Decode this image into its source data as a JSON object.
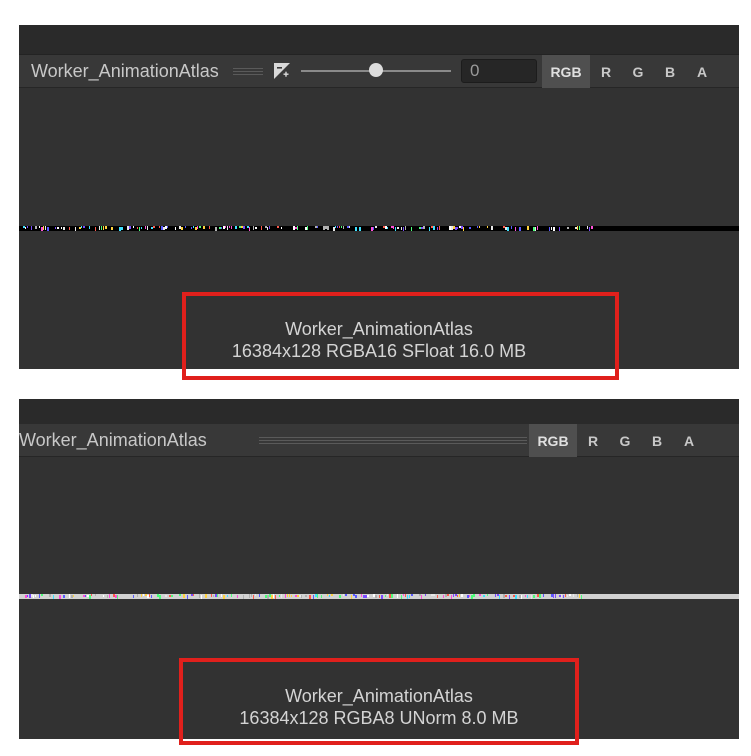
{
  "colors": {
    "panel_background": "#323232",
    "toolbar_background": "#383838",
    "highlight": "#e0201c",
    "top_strip": "#000000",
    "bottom_strip": "#d2d2d2"
  },
  "panels": [
    {
      "toolbar": {
        "texture_name": "Worker_AnimationAtlas",
        "exposure_icon": "exposure-icon",
        "exposure_value": "0",
        "channels": [
          "RGB",
          "R",
          "G",
          "B",
          "A"
        ]
      },
      "info": {
        "name": "Worker_AnimationAtlas",
        "details": "16384x128  RGBA16 SFloat   16.0 MB"
      }
    },
    {
      "toolbar": {
        "texture_name": "Worker_AnimationAtlas",
        "channels": [
          "RGB",
          "R",
          "G",
          "B",
          "A"
        ]
      },
      "info": {
        "name": "Worker_AnimationAtlas",
        "details": "16384x128  RGBA8 UNorm   8.0 MB"
      }
    }
  ]
}
